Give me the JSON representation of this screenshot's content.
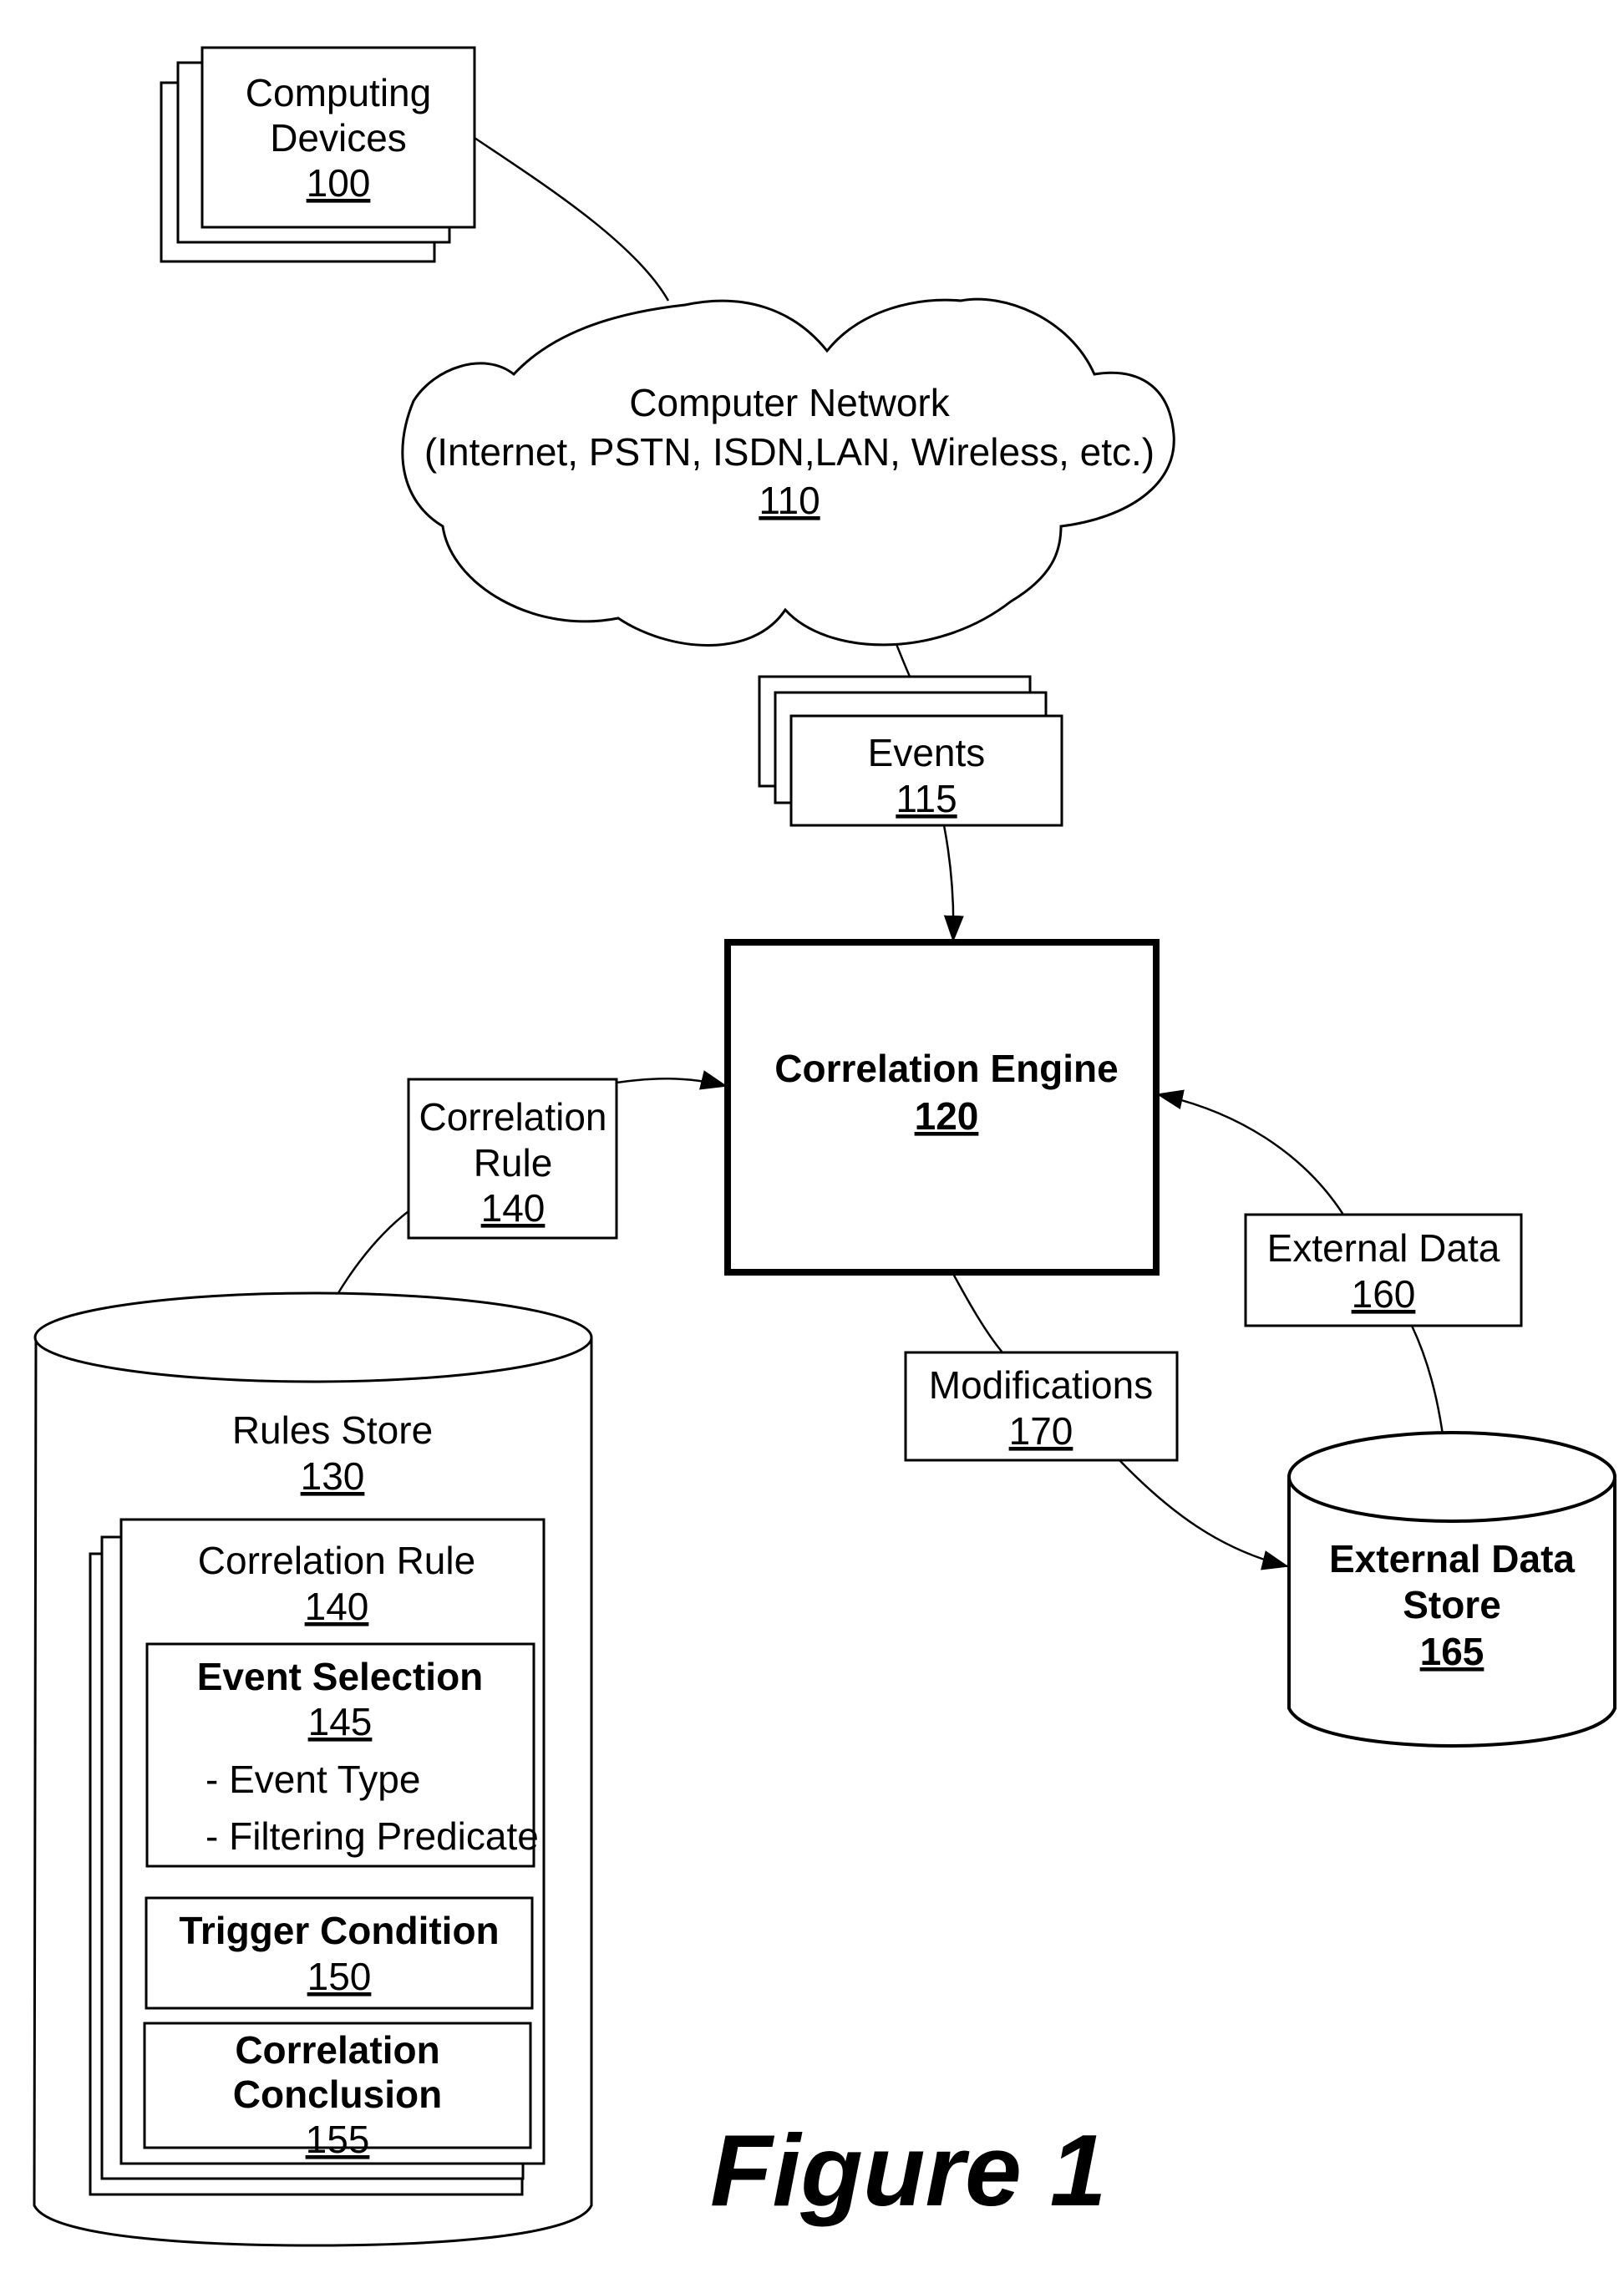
{
  "figure": {
    "caption": "Figure 1"
  },
  "nodes": {
    "computing_devices": {
      "label_line1": "Computing",
      "label_line2": "Devices",
      "ref": "100"
    },
    "computer_network": {
      "label_line1": "Computer Network",
      "label_line2": "(Internet, PSTN, ISDN,LAN, Wireless, etc.)",
      "ref": "110"
    },
    "events": {
      "label": "Events",
      "ref": "115"
    },
    "correlation_engine": {
      "label": "Correlation Engine",
      "ref": "120"
    },
    "correlation_rule_msg": {
      "label_line1": "Correlation",
      "label_line2": "Rule",
      "ref": "140"
    },
    "rules_store": {
      "label": "Rules Store",
      "ref": "130",
      "rule": {
        "label": "Correlation Rule",
        "ref": "140",
        "event_selection": {
          "label": "Event Selection",
          "ref": "145",
          "items": [
            "- Event Type",
            "- Filtering Predicate"
          ]
        },
        "trigger_condition": {
          "label": "Trigger Condition",
          "ref": "150"
        },
        "correlation_conclusion": {
          "label_line1": "Correlation",
          "label_line2": "Conclusion",
          "ref": "155"
        }
      }
    },
    "external_data": {
      "label": "External Data",
      "ref": "160"
    },
    "external_data_store": {
      "label_line1": "External Data",
      "label_line2": "Store",
      "ref": "165"
    },
    "modifications": {
      "label": "Modifications",
      "ref": "170"
    }
  },
  "edges": [
    {
      "from": "computing_devices",
      "to": "computer_network",
      "arrow": false
    },
    {
      "from": "computer_network",
      "to": "events",
      "arrow": false
    },
    {
      "from": "events",
      "to": "correlation_engine",
      "arrow": true
    },
    {
      "from": "rules_store",
      "to": "correlation_engine",
      "via": "correlation_rule_msg",
      "arrow": true
    },
    {
      "from": "external_data_store",
      "to": "correlation_engine",
      "via": "external_data",
      "arrow": true
    },
    {
      "from": "correlation_engine",
      "to": "external_data_store",
      "via": "modifications",
      "arrow": true
    }
  ]
}
